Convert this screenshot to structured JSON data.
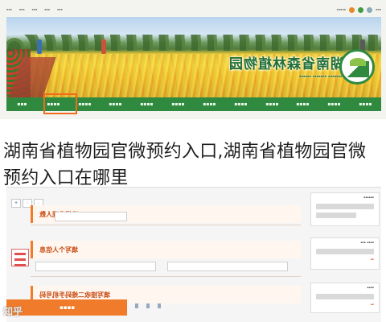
{
  "headline": "湖南省植物园官微预约入口,湖南省植物园官微预约入口在哪里",
  "site": {
    "title_mirrored": "湖南省森林植物园",
    "nav_highlight_color": "#f26a1b",
    "nav_color": "#2f8a3f"
  },
  "form": {
    "steps": [
      {
        "label_mirrored": "选择参观人数"
      },
      {
        "label_mirrored": "填写个人信息"
      },
      {
        "label_mirrored": "填写接收二维码手机号码"
      }
    ],
    "accent_color": "#f07b2a"
  },
  "watermark": "知乎"
}
